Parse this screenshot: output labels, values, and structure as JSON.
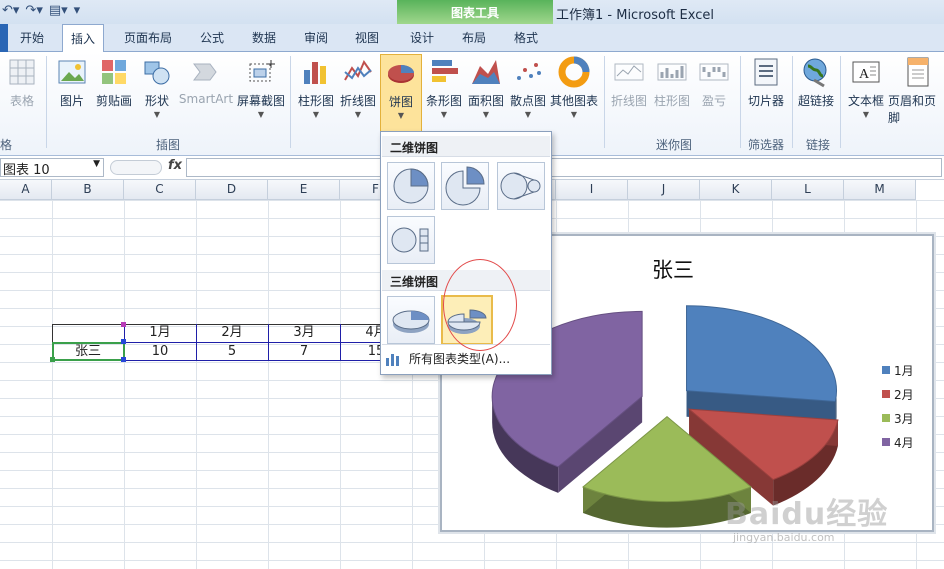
{
  "window": {
    "context_tab_group": "图表工具",
    "title": "工作簿1 - Microsoft Excel"
  },
  "tabs": [
    "开始",
    "插入",
    "页面布局",
    "公式",
    "数据",
    "审阅",
    "视图",
    "设计",
    "布局",
    "格式"
  ],
  "active_tab": "插入",
  "ribbon": {
    "buttons": {
      "table": "表格",
      "picture": "图片",
      "clipart": "剪贴画",
      "shapes": "形状",
      "smartart": "SmartArt",
      "screenshot": "屏幕截图",
      "column": "柱形图",
      "line": "折线图",
      "pie": "饼图",
      "bar": "条形图",
      "area": "面积图",
      "scatter": "散点图",
      "other": "其他图表",
      "spark_line": "折线图",
      "spark_column": "柱形图",
      "spark_winloss": "盈亏",
      "slicer": "切片器",
      "hyperlink": "超链接",
      "textbox": "文本框",
      "header_footer": "页眉和页脚"
    },
    "groups": {
      "tables_partial": "格",
      "illustrations": "插图",
      "sparklines": "迷你图",
      "filter": "筛选器",
      "links": "链接"
    }
  },
  "formula_bar": {
    "name_box": "图表 10",
    "fx_label": "fx",
    "value": ""
  },
  "columns": [
    "A",
    "B",
    "C",
    "D",
    "E",
    "F",
    "G",
    "H",
    "I",
    "J",
    "K",
    "L",
    "M"
  ],
  "sheet": {
    "header_row": [
      "",
      "1月",
      "2月",
      "3月",
      "4月"
    ],
    "data_row": [
      "张三",
      "10",
      "5",
      "7",
      "15"
    ]
  },
  "pie_menu": {
    "section_2d": "二维饼图",
    "section_3d": "三维饼图",
    "all_chart_types": "所有图表类型(A)..."
  },
  "chart_data": {
    "type": "pie",
    "title": "张三",
    "categories": [
      "1月",
      "2月",
      "3月",
      "4月"
    ],
    "values": [
      10,
      5,
      7,
      15
    ],
    "colors": [
      "#4f81bd",
      "#c0504d",
      "#9bbb59",
      "#8064a2"
    ],
    "exploded": true,
    "style": "3d",
    "legend_position": "right"
  },
  "watermark": {
    "brand": "Baidu经验",
    "url": "jingyan.baidu.com"
  }
}
